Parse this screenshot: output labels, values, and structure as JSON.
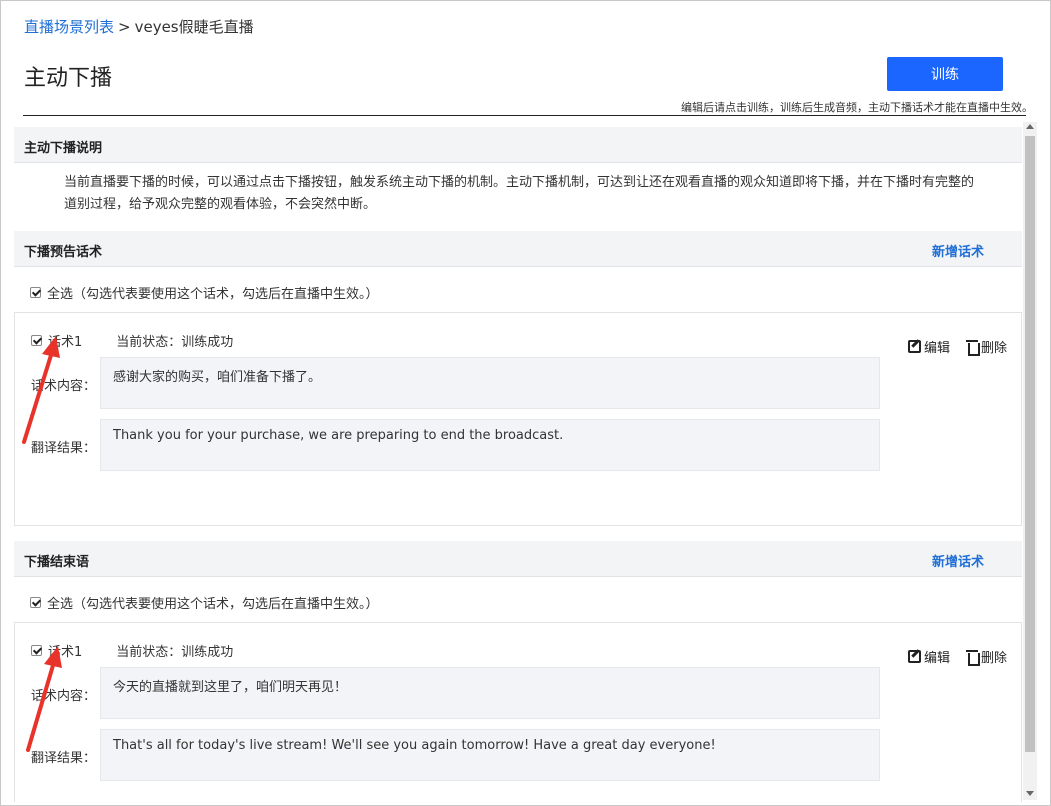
{
  "breadcrumb": {
    "parent": "直播场景列表",
    "separator": ">",
    "current": "veyes假睫毛直播"
  },
  "page": {
    "title": "主动下播",
    "train_label": "训练",
    "hint": "编辑后请点击训练，训练后生成音频，主动下播话术才能在直播中生效。"
  },
  "intro": {
    "title": "主动下播说明",
    "text": "当前直播要下播的时候，可以通过点击下播按钮，触发系统主动下播的机制。主动下播机制，可达到让还在观看直播的观众知道即将下播，并在下播时有完整的道别过程，给予观众完整的观看体验，不会突然中断。"
  },
  "sections": [
    {
      "title": "下播预告话术",
      "add_label": "新增话术",
      "select_all": "全选（勾选代表要使用这个话术，勾选后在直播中生效。）",
      "script": {
        "name": "话术1",
        "status": "当前状态：训练成功",
        "content_label": "话术内容：",
        "content": "感谢大家的购买，咱们准备下播了。",
        "translation_label": "翻译结果：",
        "translation": "Thank you for your purchase, we are preparing to end the broadcast.",
        "edit_label": "编辑",
        "delete_label": "删除"
      }
    },
    {
      "title": "下播结束语",
      "add_label": "新增话术",
      "select_all": "全选（勾选代表要使用这个话术，勾选后在直播中生效。）",
      "script": {
        "name": "话术1",
        "status": "当前状态：训练成功",
        "content_label": "话术内容：",
        "content": "今天的直播就到这里了，咱们明天再见！",
        "translation_label": "翻译结果：",
        "translation": "That's all for today's live stream! We'll see you again tomorrow! Have a great day everyone!",
        "edit_label": "编辑",
        "delete_label": "删除"
      }
    }
  ],
  "colors": {
    "accent": "#1a66ff",
    "link": "#1f6fd6",
    "annotation_arrow": "#e8332a"
  }
}
